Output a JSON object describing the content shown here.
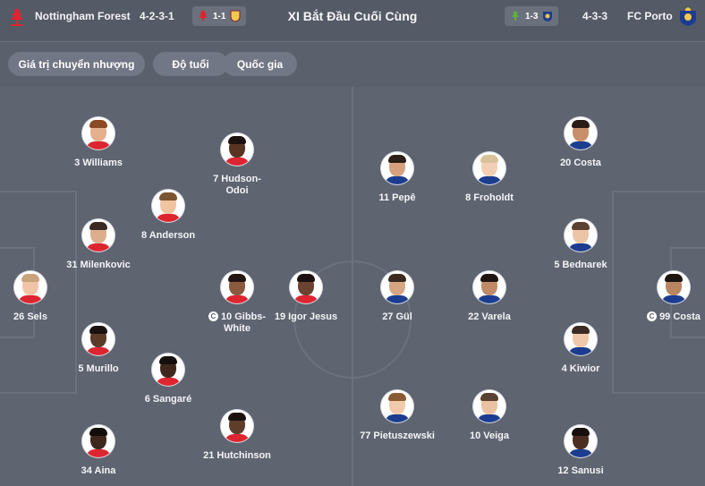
{
  "header": {
    "title": "XI Bắt Đầu Cuối Cùng",
    "home_team": "Nottingham Forest",
    "home_formation": "4-2-3-1",
    "home_score_chip": "1-1",
    "away_team": "FC Porto",
    "away_formation": "4-3-3",
    "away_score_chip": "1-3",
    "colors": {
      "forest_red": "#dd2530",
      "porto_blue": "#1c3d8f",
      "villa_claret": "#7a2038",
      "villa_yellow": "#f2c84b",
      "green_crest": "#5db33b"
    }
  },
  "filters": {
    "market_value": "Giá trị chuyển nhượng",
    "age": "Độ tuổi",
    "nationality": "Quốc gia"
  },
  "captain_icon": "C",
  "home_players": [
    {
      "label": "3 Williams",
      "captain": false,
      "skin": "#e4b08e",
      "hair": "#8a4a25",
      "kit": "#dd2530"
    },
    {
      "label": "7 Hudson-\nOdoi",
      "captain": false,
      "skin": "#5a3423",
      "hair": "#1d1210",
      "kit": "#dd2530"
    },
    {
      "label": "8 Anderson",
      "captain": false,
      "skin": "#f0c3a1",
      "hair": "#7b5531",
      "kit": "#dd2530"
    },
    {
      "label": "31 Milenkovic",
      "captain": false,
      "skin": "#dcae8d",
      "hair": "#3a2a22",
      "kit": "#dd2530"
    },
    {
      "label": "26 Sels",
      "captain": false,
      "skin": "#f1c4a6",
      "hair": "#c9a37e",
      "kit": "#dd2530"
    },
    {
      "label": "10 Gibbs-\nWhite",
      "captain": true,
      "skin": "#8a5a3e",
      "hair": "#241610",
      "kit": "#dd2530"
    },
    {
      "label": "19 Igor Jesus",
      "captain": false,
      "skin": "#6b4330",
      "hair": "#1a1110",
      "kit": "#dd2530"
    },
    {
      "label": "5 Murillo",
      "captain": false,
      "skin": "#5c3a28",
      "hair": "#1a1110",
      "kit": "#dd2530"
    },
    {
      "label": "6 Sangaré",
      "captain": false,
      "skin": "#3f271d",
      "hair": "#140e0c",
      "kit": "#dd2530"
    },
    {
      "label": "34 Aina",
      "captain": false,
      "skin": "#3e271c",
      "hair": "#120c0a",
      "kit": "#dd2530"
    },
    {
      "label": "21 Hutchinson",
      "captain": false,
      "skin": "#5f3d2b",
      "hair": "#1b1210",
      "kit": "#dd2530"
    }
  ],
  "away_players": [
    {
      "label": "20 Costa",
      "captain": false,
      "skin": "#c98f6a",
      "hair": "#2a1d16",
      "kit": "#1c3d8f"
    },
    {
      "label": "11 Pepê",
      "captain": false,
      "skin": "#d6a07f",
      "hair": "#2b1f18",
      "kit": "#1c3d8f"
    },
    {
      "label": "8 Froholdt",
      "captain": false,
      "skin": "#f2cfb4",
      "hair": "#d9c29a",
      "kit": "#1c3d8f"
    },
    {
      "label": "5 Bednarek",
      "captain": false,
      "skin": "#ecc4a6",
      "hair": "#5c4030",
      "kit": "#1c3d8f"
    },
    {
      "label": "27 Gül",
      "captain": false,
      "skin": "#d7a584",
      "hair": "#3a2a20",
      "kit": "#1c3d8f"
    },
    {
      "label": "22 Varela",
      "captain": false,
      "skin": "#c08a66",
      "hair": "#1f1612",
      "kit": "#1c3d8f"
    },
    {
      "label": "99 Costa",
      "captain": true,
      "skin": "#b98462",
      "hair": "#1d1510",
      "kit": "#1c3d8f"
    },
    {
      "label": "4 Kiwior",
      "captain": false,
      "skin": "#efc8aa",
      "hair": "#3b2b22",
      "kit": "#1c3d8f"
    },
    {
      "label": "77 Pietuszewski",
      "captain": false,
      "skin": "#f1c9ab",
      "hair": "#8a5a35",
      "kit": "#1c3d8f"
    },
    {
      "label": "10 Veiga",
      "captain": false,
      "skin": "#eac2a2",
      "hair": "#5a4030",
      "kit": "#1c3d8f"
    },
    {
      "label": "12 Sanusi",
      "captain": false,
      "skin": "#4a2e22",
      "hair": "#160f0c",
      "kit": "#1c3d8f"
    }
  ]
}
